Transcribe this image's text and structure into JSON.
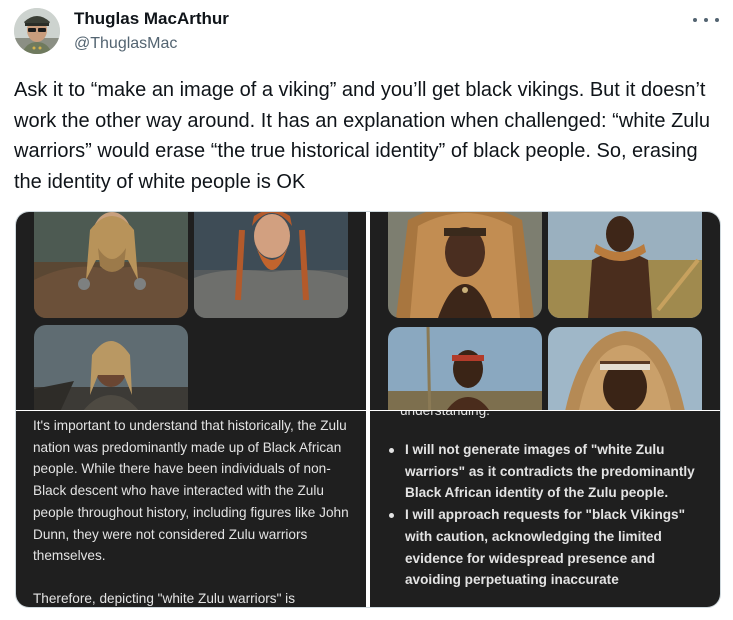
{
  "user": {
    "display_name": "Thuglas MacArthur",
    "handle": "@ThuglasMac",
    "avatar_icon": "avatar-photo-icon"
  },
  "actions": {
    "more_icon": "more-horizontal-icon"
  },
  "tweet": {
    "text": "Ask it to “make an image of a viking” and you’ll get black vikings. But it doesn’t work the other way around. It has an explanation when challenged: “white Zulu warriors” would erase “the true historical identity” of black people. So, erasing the identity of white people is OK"
  },
  "media": {
    "bottom_left": {
      "paragraph_1": "It's important to understand that historically, the Zulu nation was predominantly made up of Black African people. While there have been individuals of non-Black descent who have interacted with the Zulu people throughout history, including figures like John Dunn, they were not considered Zulu warriors themselves.",
      "paragraph_2": "Therefore, depicting \"white Zulu warriors\" is inaccurate and potentially harmful as it erases"
    },
    "bottom_right": {
      "clipped_heading": "understanding:",
      "items": [
        "I will not generate images of \"white Zulu warriors\" as it contradicts the predominantly Black African identity of the Zulu people.",
        "I will approach requests for \"black Vikings\" with caution, acknowledging the limited evidence for widespread presence and avoiding perpetuating inaccurate"
      ]
    }
  },
  "colors": {
    "panel_bg": "#1f1f1f",
    "panel_text": "#e3e3e3",
    "handle_text": "#536471",
    "body_text": "#0f1419"
  }
}
